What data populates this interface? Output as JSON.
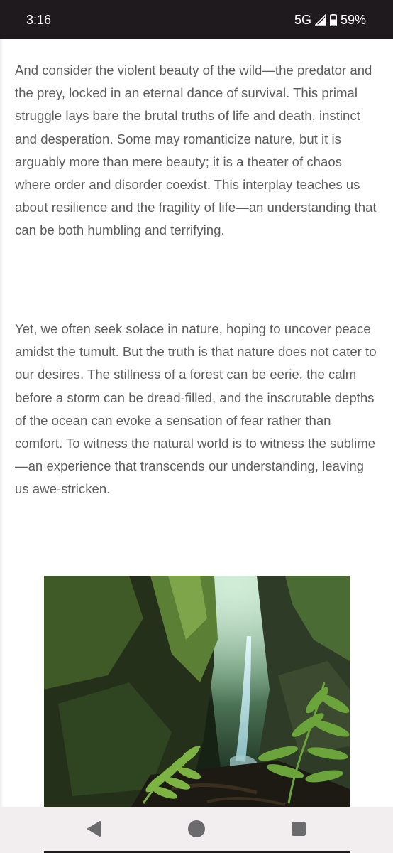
{
  "status_bar": {
    "time": "3:16",
    "network": "5G",
    "battery": "59%",
    "icons": [
      "signal-icon",
      "battery-icon"
    ]
  },
  "article": {
    "paragraphs": [
      "And consider the violent beauty of the wild—the predator and the prey, locked in an eternal dance of survival. This primal struggle lays bare the brutal truths of life and death, instinct and desperation. Some may romanticize nature, but it is arguably more than mere beauty; it is a theater of chaos where order and disorder coexist. This interplay teaches us about resilience and the fragility of life—an understanding that can be both humbling and terrifying.",
      "Yet, we often seek solace in nature, hoping to uncover peace amidst the tumult. But the truth is that nature does not cater to our desires. The stillness of a forest can be eerie, the calm before a storm can be dread-filled, and the inscrutable depths of the ocean can evoke a sensation of fear rather than comfort. To witness the natural world is to witness the sublime—an experience that transcends our understanding, leaving us awe-stricken."
    ]
  },
  "nav_bar": {
    "icons": [
      "back-icon",
      "home-icon",
      "recents-icon"
    ]
  },
  "colors": {
    "status_bar_bg": "#1f1a1d",
    "body_text": "#5c5c5c",
    "nav_bar_bg": "#f2eef0",
    "nav_icon": "#6b6a6c"
  }
}
